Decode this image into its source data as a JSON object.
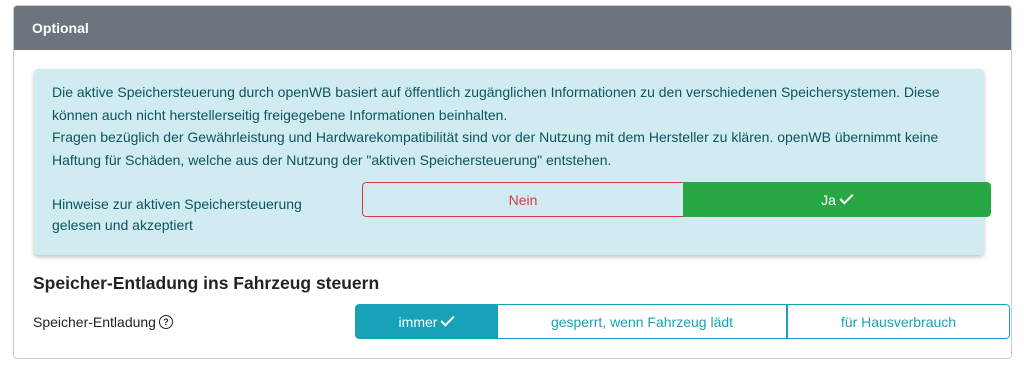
{
  "card": {
    "header_title": "Optional"
  },
  "alert": {
    "paragraph1": "Die aktive Speichersteuerung durch openWB basiert auf öffentlich zugänglichen Informationen zu den verschiedenen Speichersystemen. Diese können auch nicht herstellerseitig freigegebene Informationen beinhalten.",
    "paragraph2": "Fragen bezüglich der Gewährleistung und Hardwarekompatibilität sind vor der Nutzung mit dem Hersteller zu klären. openWB übernimmt keine Haftung für Schäden, welche aus der Nutzung der \"aktiven Speichersteuerung\" entstehen.",
    "confirm_label": "Hinweise zur aktiven Speichersteuerung gelesen und akzeptiert",
    "toggle": {
      "no_label": "Nein",
      "yes_label": "Ja",
      "selected": "Ja"
    }
  },
  "section": {
    "title": "Speicher-Entladung ins Fahrzeug steuern",
    "row_label": "Speicher-Entladung",
    "help_icon": "question-circle-icon",
    "options": [
      "immer",
      "gesperrt, wenn Fahrzeug lädt",
      "für Hausverbrauch"
    ],
    "selected": "immer"
  },
  "colors": {
    "header_bg": "#6c757d",
    "alert_bg": "#d1ecf1",
    "alert_text": "#0c5460",
    "danger": "#dc3545",
    "success": "#28a745",
    "info": "#17a2b8"
  }
}
